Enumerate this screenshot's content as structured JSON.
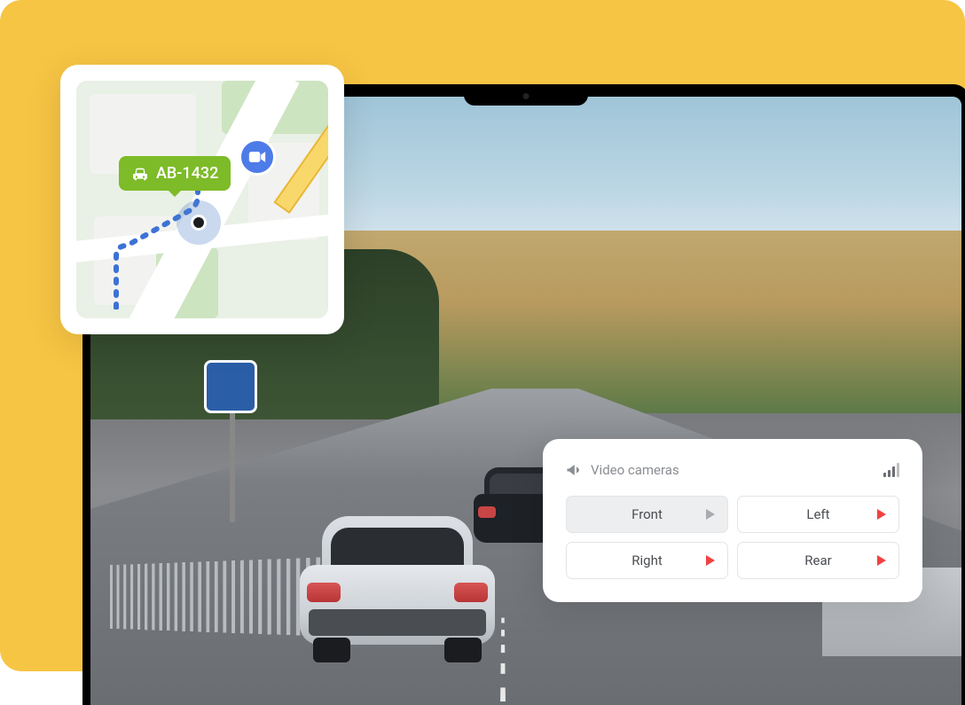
{
  "map": {
    "vehicle_label": "AB-1432"
  },
  "cameras": {
    "title": "Video cameras",
    "buttons": {
      "front": "Front",
      "left": "Left",
      "right": "Right",
      "rear": "Rear"
    }
  }
}
